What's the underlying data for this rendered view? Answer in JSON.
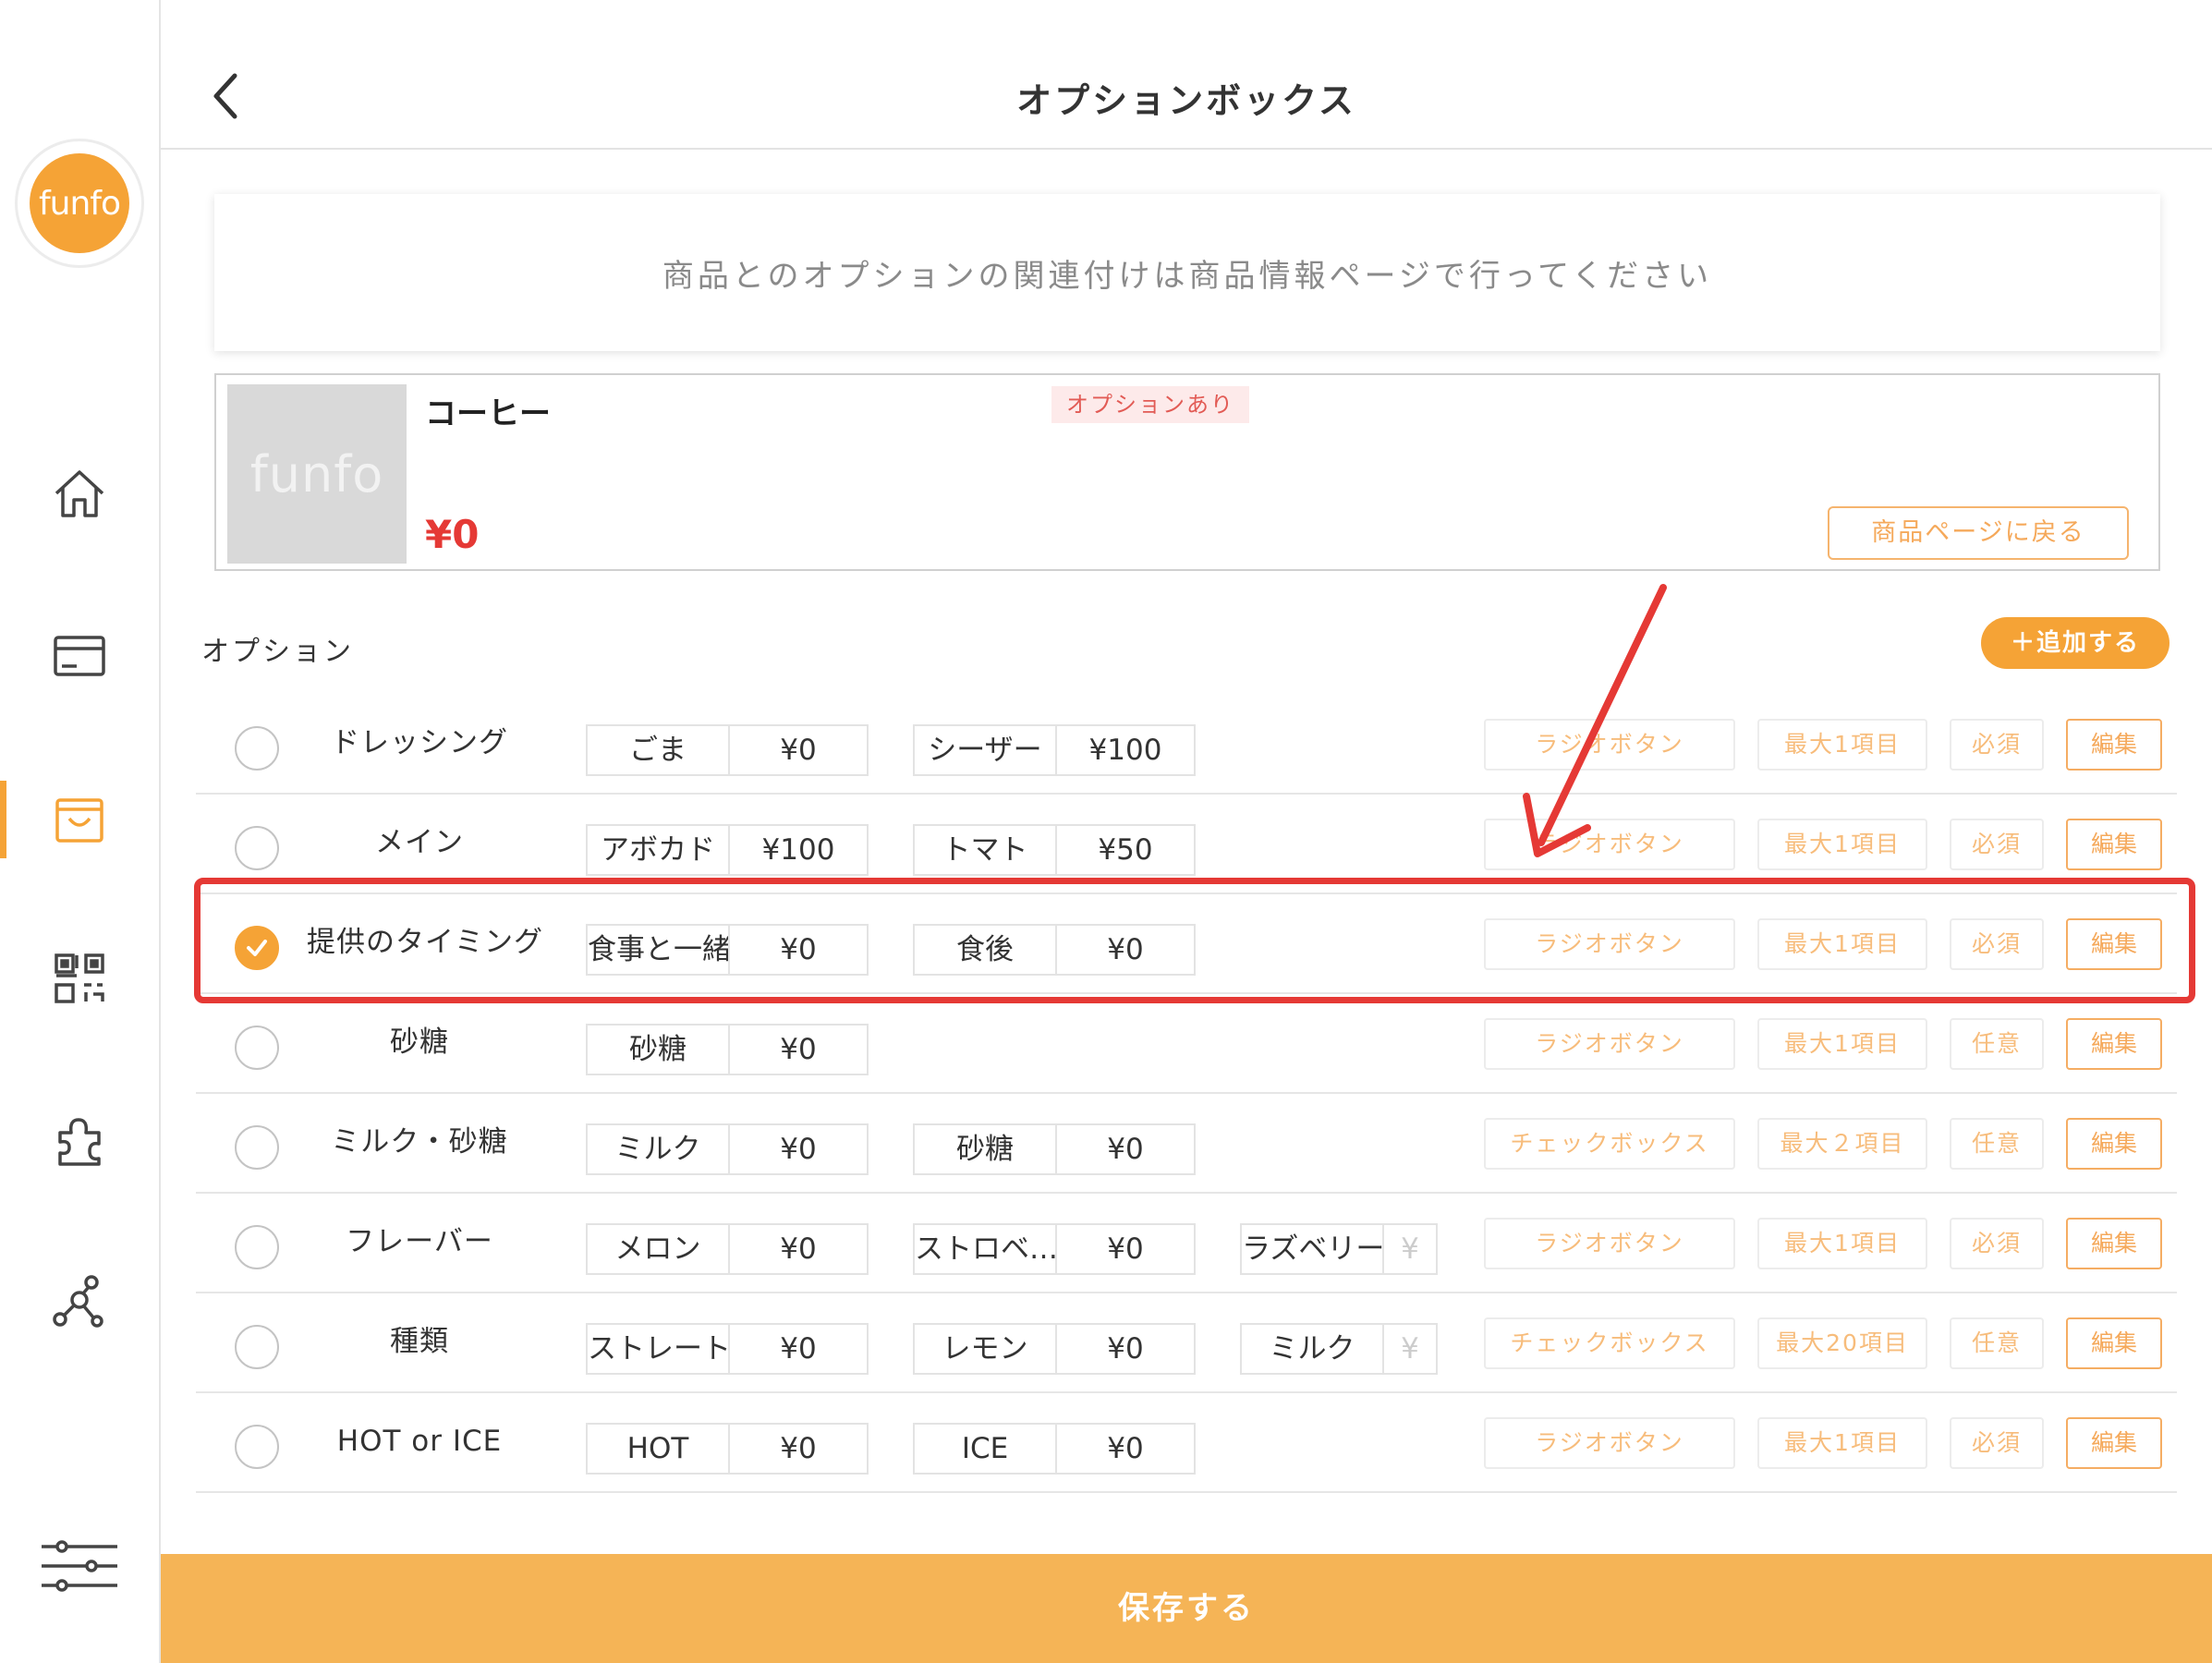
{
  "header": {
    "title": "オプションボックス"
  },
  "sidebar": {
    "logo_text": "funfo"
  },
  "notice": {
    "text": "商品とのオプションの関連付けは商品情報ページで行ってください"
  },
  "product": {
    "image_text": "funfo",
    "name": "コーヒー",
    "price": "¥0",
    "badge": "オプションあり",
    "back_button": "商品ページに戻る"
  },
  "options_section": {
    "label": "オプション",
    "add_button": "＋追加する"
  },
  "options": [
    {
      "name": "ドレッシング",
      "checked": false,
      "choices": [
        {
          "name": "ごま",
          "price": "¥0"
        },
        {
          "name": "シーザー",
          "price": "¥100"
        }
      ],
      "type": "ラジオボタン",
      "max": "最大1項目",
      "required": "必須",
      "edit": "編集"
    },
    {
      "name": "メイン",
      "checked": false,
      "choices": [
        {
          "name": "アボカド",
          "price": "¥100"
        },
        {
          "name": "トマト",
          "price": "¥50"
        }
      ],
      "type": "ラジオボタン",
      "max": "最大1項目",
      "required": "必須",
      "edit": "編集"
    },
    {
      "name": "提供のタイミング",
      "checked": true,
      "choices": [
        {
          "name": "食事と一緒",
          "price": "¥0"
        },
        {
          "name": "食後",
          "price": "¥0"
        }
      ],
      "type": "ラジオボタン",
      "max": "最大1項目",
      "required": "必須",
      "edit": "編集"
    },
    {
      "name": "砂糖",
      "checked": false,
      "choices": [
        {
          "name": "砂糖",
          "price": "¥0"
        }
      ],
      "type": "ラジオボタン",
      "max": "最大1項目",
      "required": "任意",
      "edit": "編集"
    },
    {
      "name": "ミルク・砂糖",
      "checked": false,
      "choices": [
        {
          "name": "ミルク",
          "price": "¥0"
        },
        {
          "name": "砂糖",
          "price": "¥0"
        }
      ],
      "type": "チェックボックス",
      "max": "最大２項目",
      "required": "任意",
      "edit": "編集"
    },
    {
      "name": "フレーバー",
      "checked": false,
      "choices": [
        {
          "name": "メロン",
          "price": "¥0"
        },
        {
          "name": "ストロベ…",
          "price": "¥0"
        },
        {
          "name": "ラズベリー",
          "price": "¥"
        }
      ],
      "type": "ラジオボタン",
      "max": "最大1項目",
      "required": "必須",
      "edit": "編集"
    },
    {
      "name": "種類",
      "checked": false,
      "choices": [
        {
          "name": "ストレート",
          "price": "¥0"
        },
        {
          "name": "レモン",
          "price": "¥0"
        },
        {
          "name": "ミルク",
          "price": "¥"
        }
      ],
      "type": "チェックボックス",
      "max": "最大20項目",
      "required": "任意",
      "edit": "編集"
    },
    {
      "name": "HOT or ICE",
      "checked": false,
      "choices": [
        {
          "name": "HOT",
          "price": "¥0"
        },
        {
          "name": "ICE",
          "price": "¥0"
        }
      ],
      "type": "ラジオボタン",
      "max": "最大1項目",
      "required": "必須",
      "edit": "編集"
    }
  ],
  "save_button": "保存する",
  "colors": {
    "accent": "#f5a336",
    "price_red": "#e53935",
    "annotation_red": "#e53935"
  },
  "icons": [
    "home-icon",
    "card-icon",
    "shop-icon",
    "qr-code-icon",
    "puzzle-icon",
    "network-icon",
    "settings-sliders-icon"
  ]
}
